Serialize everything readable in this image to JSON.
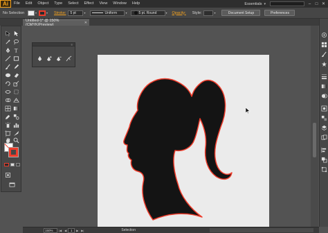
{
  "app": {
    "logo": "Ai"
  },
  "menubar": {
    "items": [
      "File",
      "Edit",
      "Object",
      "Type",
      "Select",
      "Effect",
      "View",
      "Window",
      "Help"
    ],
    "workspace": "Essentials"
  },
  "control_bar": {
    "selection_label": "No Selection",
    "stroke_label": "Stroke:",
    "stroke_weight": "5 pt",
    "profile": "Uniform",
    "brush": "5 pt. Round",
    "opacity_label": "Opacity:",
    "style_label": "Style:",
    "document_setup": "Document Setup",
    "preferences": "Preferences",
    "colors": {
      "fill": "#eeeeee",
      "stroke": "#ee3c2b"
    }
  },
  "document": {
    "tab_title": "Untitled-1* @ 150% (CMYK/Preview)"
  },
  "status": {
    "zoom": "150%",
    "page": "1",
    "tool": "Selection"
  },
  "artwork": {
    "artboard_color": "#ebebeb",
    "silhouette_fill": "#141414",
    "silhouette_stroke": "#ee3c2b"
  }
}
